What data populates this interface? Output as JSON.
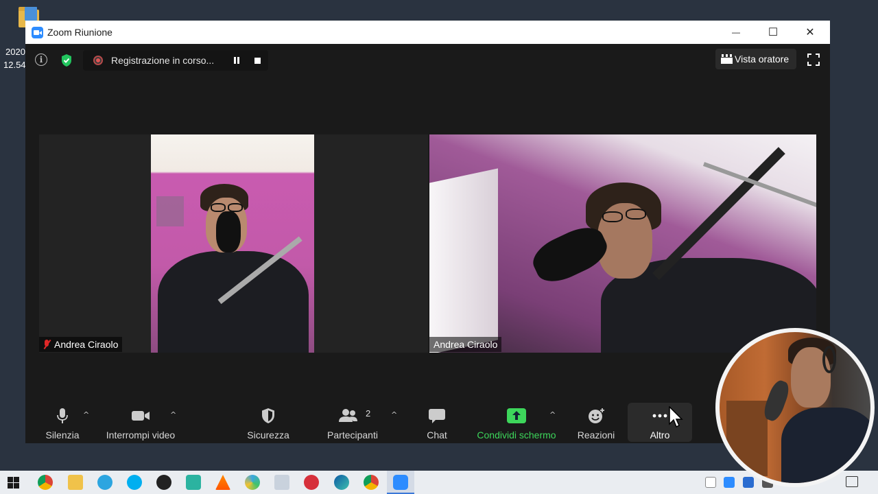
{
  "desktop": {
    "icon_label_line1": "2020",
    "icon_label_line2": "12.54"
  },
  "window": {
    "title": "Zoom Riunione",
    "minimize_glyph": "—",
    "maximize_glyph": "☐",
    "close_glyph": "✕"
  },
  "topbar": {
    "info_glyph": "i",
    "recording_text": "Registrazione in corso...",
    "view_label": "Vista oratore"
  },
  "participants": [
    {
      "name": "Andrea Ciraolo",
      "muted": true
    },
    {
      "name": "Andrea Ciraolo",
      "muted": false
    }
  ],
  "toolbar": {
    "mute_label": "Silenzia",
    "video_label": "Interrompi video",
    "security_label": "Sicurezza",
    "participants_label": "Partecipanti",
    "participants_count": "2",
    "chat_label": "Chat",
    "share_label": "Condividi schermo",
    "reactions_label": "Reazioni",
    "more_label": "Altro",
    "caret_glyph": "^"
  },
  "colors": {
    "share_green": "#3dd65b",
    "muted_red": "#e02828",
    "zoom_blue": "#2d8cff",
    "shield_green": "#22c55e"
  },
  "icons": {
    "mic": "microphone-icon",
    "video": "video-camera-icon",
    "security": "shield-icon",
    "participants": "people-icon",
    "chat": "chat-bubble-icon",
    "share": "share-screen-icon",
    "reactions": "smiley-plus-icon",
    "more": "ellipsis-icon"
  }
}
